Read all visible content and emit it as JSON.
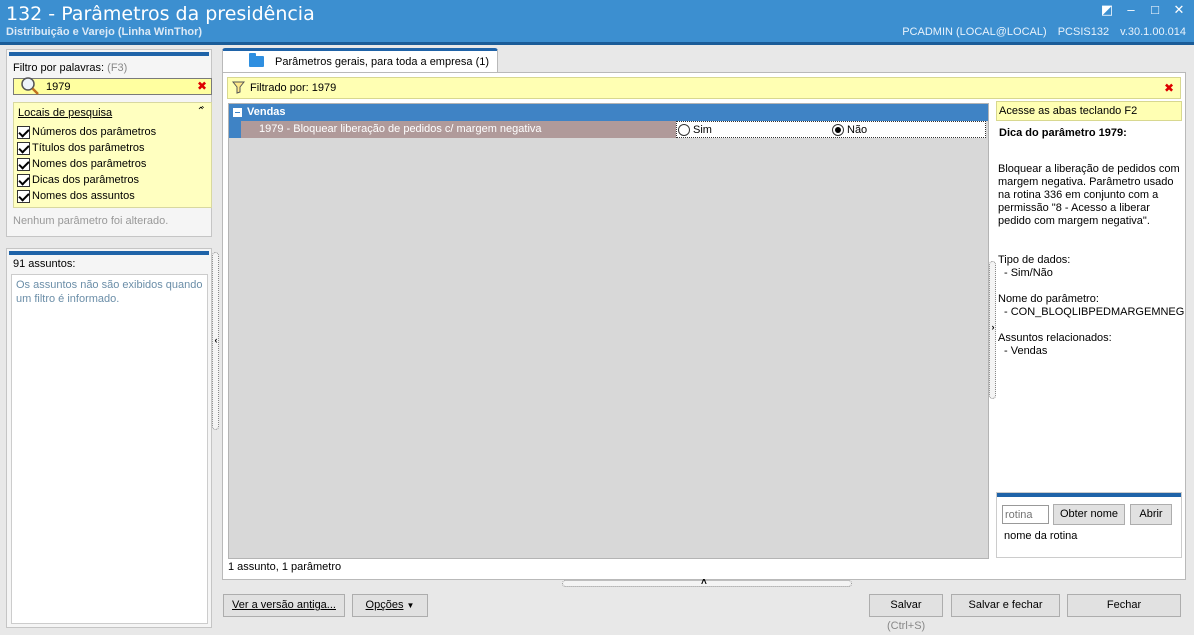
{
  "window": {
    "title": "132 - Parâmetros da presidência",
    "subtitle": "Distribuição e Varejo (Linha WinThor)",
    "user": "PCADMIN (LOCAL@LOCAL)",
    "module": "PCSIS132",
    "version": "v.30.1.00.014"
  },
  "filter": {
    "label": "Filtro por palavras:",
    "shortcut": "(F3)",
    "value": "1979",
    "locais_title": "Locais de pesquisa",
    "options": [
      {
        "label": "Números dos parâmetros",
        "checked": true
      },
      {
        "label": "Títulos dos parâmetros",
        "checked": true
      },
      {
        "label": "Nomes dos parâmetros",
        "checked": true
      },
      {
        "label": "Dicas dos parâmetros",
        "checked": true
      },
      {
        "label": "Nomes dos assuntos",
        "checked": true
      }
    ],
    "status": "Nenhum parâmetro foi alterado."
  },
  "assuntos": {
    "label": "91 assuntos:",
    "message": "Os assuntos não são exibidos quando um filtro é informado."
  },
  "tab": {
    "label": "Parâmetros gerais, para toda a empresa",
    "count": "(1)"
  },
  "filterbar": {
    "text": "Filtrado por: 1979"
  },
  "grid": {
    "group": "Vendas",
    "row": {
      "description": "1979 - Bloquear liberação de pedidos c/ margem negativa",
      "option_yes": "Sim",
      "option_no": "Não",
      "selected": "Não"
    }
  },
  "status_bar": "1 assunto, 1 parâmetro",
  "info": {
    "hint": "Acesse as abas teclando F2",
    "tip_title": "Dica do parâmetro 1979:",
    "tip_text": "Bloquear a liberação de pedidos com margem negativa. Parâmetro usado na rotina 336 em conjunto com a permissão \"8 - Acesso a liberar pedido com margem negativa\".",
    "tipo_label": "Tipo de dados:",
    "tipo_value": "- Sim/Não",
    "nome_label": "Nome do parâmetro:",
    "nome_value": "- CON_BLOQLIBPEDMARGEMNEG",
    "assuntos_label": "Assuntos relacionados:",
    "assuntos_value": "- Vendas"
  },
  "rotina": {
    "placeholder": "rotina",
    "obter_label": "Obter nome",
    "abrir_label": "Abrir",
    "caption": "nome da rotina"
  },
  "buttons": {
    "versao_antiga": "Ver a versão antiga...",
    "opcoes": "Opções",
    "salvar": "Salvar",
    "salvar_shortcut": "(Ctrl+S)",
    "salvar_fechar": "Salvar e fechar",
    "fechar": "Fechar"
  }
}
